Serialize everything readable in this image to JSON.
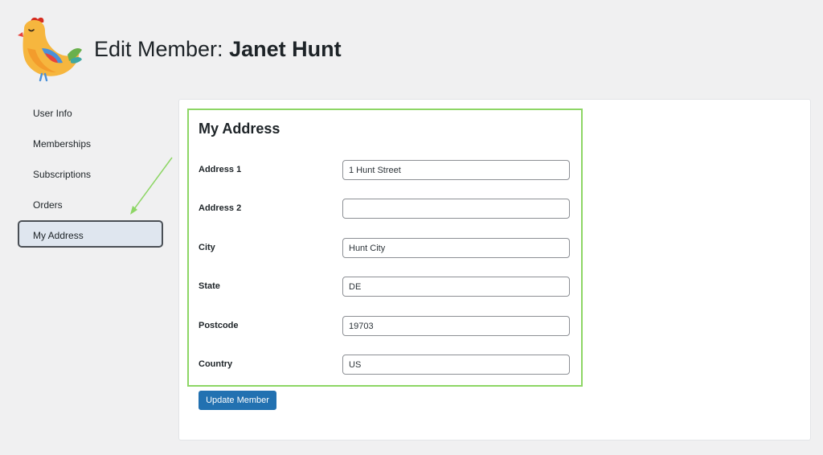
{
  "header": {
    "title_prefix": "Edit Member:",
    "member_name": "Janet Hunt",
    "logo_icon": "chicken-logo-icon"
  },
  "sidebar": {
    "items": [
      {
        "label": "User Info",
        "active": false
      },
      {
        "label": "Memberships",
        "active": false
      },
      {
        "label": "Subscriptions",
        "active": false
      },
      {
        "label": "Orders",
        "active": false
      },
      {
        "label": "My Address",
        "active": true
      }
    ]
  },
  "section": {
    "title": "My Address",
    "fields": [
      {
        "label": "Address 1",
        "value": "1 Hunt Street"
      },
      {
        "label": "Address 2",
        "value": ""
      },
      {
        "label": "City",
        "value": "Hunt City"
      },
      {
        "label": "State",
        "value": "DE"
      },
      {
        "label": "Postcode",
        "value": "19703"
      },
      {
        "label": "Country",
        "value": "US"
      }
    ]
  },
  "actions": {
    "update_label": "Update Member"
  },
  "colors": {
    "background": "#f0f0f1",
    "primary_button": "#2271b1",
    "highlight_border": "#8dd665",
    "active_nav_bg": "#dfe6ef"
  }
}
